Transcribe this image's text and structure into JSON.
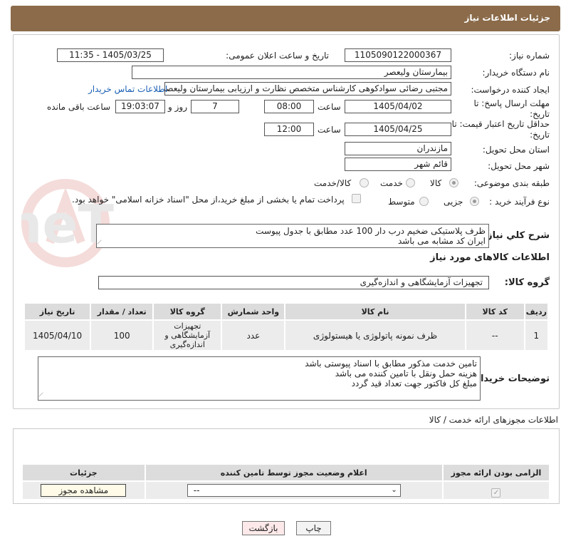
{
  "header": {
    "title": "جزئیات اطلاعات نیاز"
  },
  "fields": {
    "need_number_label": "شماره نیاز:",
    "need_number": "1105090122000367",
    "announce_label": "تاریخ و ساعت اعلان عمومی:",
    "announce_value": "1405/03/25 - 11:35",
    "buyer_org_label": "نام دستگاه خریدار:",
    "buyer_org": "بیمارستان ولیعصر",
    "creator_label": "ایجاد کننده درخواست:",
    "creator": "مجتبی رضائی سوادکوهی کارشناس متخصص نظارت و ارزیابی بیمارستان ولیعصر",
    "contact_link": "اطلاعات تماس خریدار",
    "reply_deadline_label": "مهلت ارسال پاسخ: تا تاریخ:",
    "reply_date": "1405/04/02",
    "time_label": "ساعت",
    "reply_time": "08:00",
    "days_value": "7",
    "days_label": "روز و",
    "remaining_time": "19:03:07",
    "remaining_label": "ساعت باقی مانده",
    "validity_label": "حداقل تاریخ اعتبار قیمت: تا تاریخ:",
    "validity_date": "1405/04/25",
    "validity_time": "12:00",
    "province_label": "استان محل تحویل:",
    "province": "مازندران",
    "city_label": "شهر محل تحویل:",
    "city": "قائم شهر",
    "category_label": "طبقه بندی موضوعی:",
    "category_options": [
      "کالا",
      "خدمت",
      "کالا/خدمت"
    ],
    "process_label": "نوع فرآیند خرید :",
    "process_options": [
      "جزیی",
      "متوسط"
    ],
    "payment_note": "پرداخت تمام یا بخشی از مبلغ خرید،از محل \"اسناد خزانه اسلامی\" خواهد بود."
  },
  "summary": {
    "label": "شرح کلي نياز:",
    "lines": [
      "ظرف پلاستیکی ضخیم درب دار 100 عدد مطابق با جدول پیوست",
      "ایران کد مشابه می باشد"
    ]
  },
  "goods_section_title": "اطلاعات کالاهای مورد نیاز",
  "goods_group": {
    "label": "گروه کالا:",
    "value": "تجهیزات آزمایشگاهی و اندازه‌گیری"
  },
  "goods_table": {
    "headers": [
      "ردیف",
      "کد کالا",
      "نام کالا",
      "واحد شمارش",
      "گروه کالا",
      "تعداد / مقدار",
      "تاریخ نیاز"
    ],
    "rows": [
      {
        "row": "1",
        "code": "--",
        "name": "ظرف نمونه پاتولوژی یا هیستولوژی",
        "unit": "عدد",
        "group": [
          "تجهیزات",
          "آزمایشگاهی و",
          "اندازه‌گیری"
        ],
        "qty": "100",
        "date": "1405/04/10"
      }
    ]
  },
  "buyer_notes": {
    "label": "توضیحات خریدار:",
    "lines": [
      "تامین خدمت مذکور مطابق با اسناد پیوستی باشد",
      "هزینه حمل ونقل با تامین کننده می باشد",
      "مبلغ کل  فاکتور جهت تعداد قید گردد"
    ]
  },
  "permits": {
    "title": "اطلاعات مجوزهای ارائه خدمت / کالا",
    "headers": [
      "الزامی بودن ارائه مجوز",
      "اعلام وضعیت مجوز توسط تامین کننده",
      "جزئیات"
    ],
    "select_value": "--",
    "view_button": "مشاهده مجوز"
  },
  "buttons": {
    "print": "چاپ",
    "back": "بازگشت"
  },
  "watermark_text": "AriaTender.neT"
}
